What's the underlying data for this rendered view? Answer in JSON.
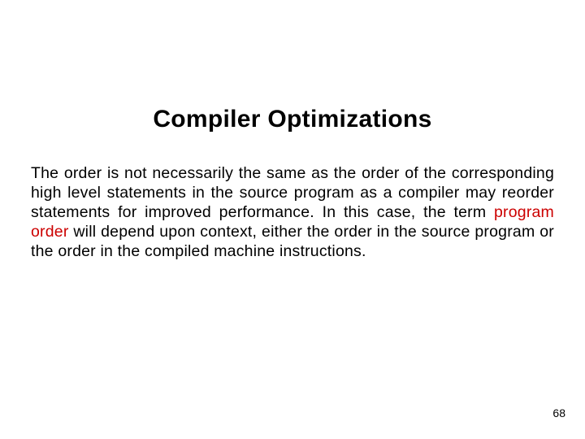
{
  "slide": {
    "title": "Compiler Optimizations",
    "body_part1": "The order is not necessarily the same as the order of the corresponding high level statements in the source program as a compiler may reorder statements for improved performance. In this case, the term ",
    "term": "program order",
    "body_part2": " will depend upon context, either the order in the source program or the order in the compiled machine instructions.",
    "page_number": "68"
  }
}
